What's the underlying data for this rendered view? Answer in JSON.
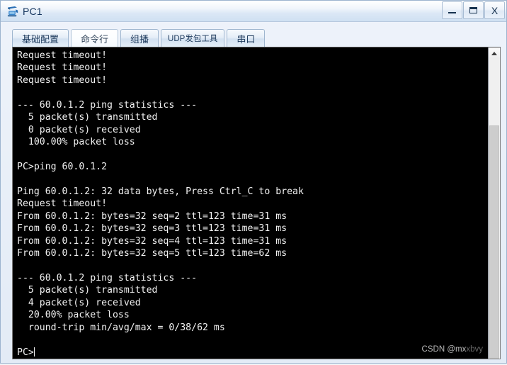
{
  "window": {
    "title": "PC1",
    "icon": "pc-device-icon",
    "controls": {
      "minimize": "–",
      "maximize": "▭",
      "close": "X"
    }
  },
  "tabs": [
    {
      "label": "基础配置",
      "active": false,
      "small": false
    },
    {
      "label": "命令行",
      "active": true,
      "small": false
    },
    {
      "label": "组播",
      "active": false,
      "small": false
    },
    {
      "label": "UDP发包工具",
      "active": false,
      "small": true
    },
    {
      "label": "串口",
      "active": false,
      "small": false
    }
  ],
  "terminal": {
    "prompt": "PC>",
    "lines": [
      "Request timeout!",
      "Request timeout!",
      "Request timeout!",
      "",
      "--- 60.0.1.2 ping statistics ---",
      "  5 packet(s) transmitted",
      "  0 packet(s) received",
      "  100.00% packet loss",
      "",
      "PC>ping 60.0.1.2",
      "",
      "Ping 60.0.1.2: 32 data bytes, Press Ctrl_C to break",
      "Request timeout!",
      "From 60.0.1.2: bytes=32 seq=2 ttl=123 time=31 ms",
      "From 60.0.1.2: bytes=32 seq=3 ttl=123 time=31 ms",
      "From 60.0.1.2: bytes=32 seq=4 ttl=123 time=31 ms",
      "From 60.0.1.2: bytes=32 seq=5 ttl=123 time=62 ms",
      "",
      "--- 60.0.1.2 ping statistics ---",
      "  5 packet(s) transmitted",
      "  4 packet(s) received",
      "  20.00% packet loss",
      "  round-trip min/avg/max = 0/38/62 ms",
      ""
    ]
  },
  "scrollbar": {
    "up_arrow": "scroll-up-arrow",
    "thumb_top_pct": 22,
    "thumb_height_pct": 78
  },
  "watermark": {
    "prefix": "CSDN @mx",
    "suffix": "xbvy"
  },
  "colors": {
    "terminal_bg": "#000000",
    "terminal_fg": "#f2f2f2",
    "title_text": "#12335c",
    "tab_text": "#1d3a5c",
    "window_border": "#9cb4cf"
  }
}
